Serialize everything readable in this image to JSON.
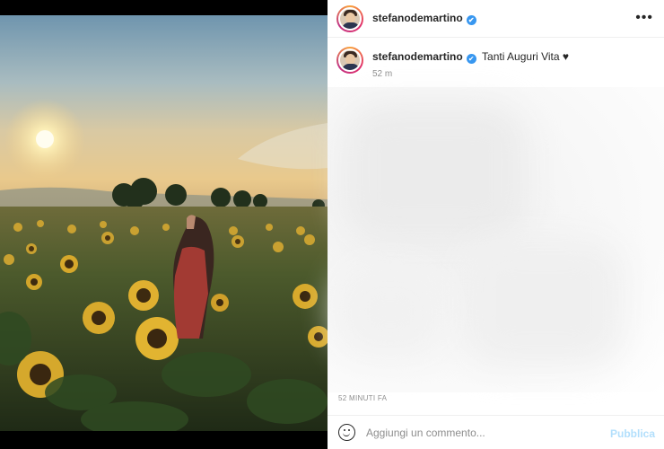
{
  "post": {
    "username": "stefanodemartino",
    "caption": "Tanti Auguri Vita ♥",
    "caption_time": "52 m",
    "posted_time": "52 MINUTI FA"
  },
  "header": {
    "more_label": "•••",
    "verified_mark": "✔"
  },
  "comment_box": {
    "placeholder": "Aggiungi un commento...",
    "publish_label": "Pubblica"
  },
  "colors": {
    "verified": "#3897f0",
    "publish_disabled": "#b2dffc",
    "muted_text": "#8e8e8e"
  },
  "icons": [
    "more-options-icon",
    "verified-badge-icon",
    "emoji-icon"
  ]
}
